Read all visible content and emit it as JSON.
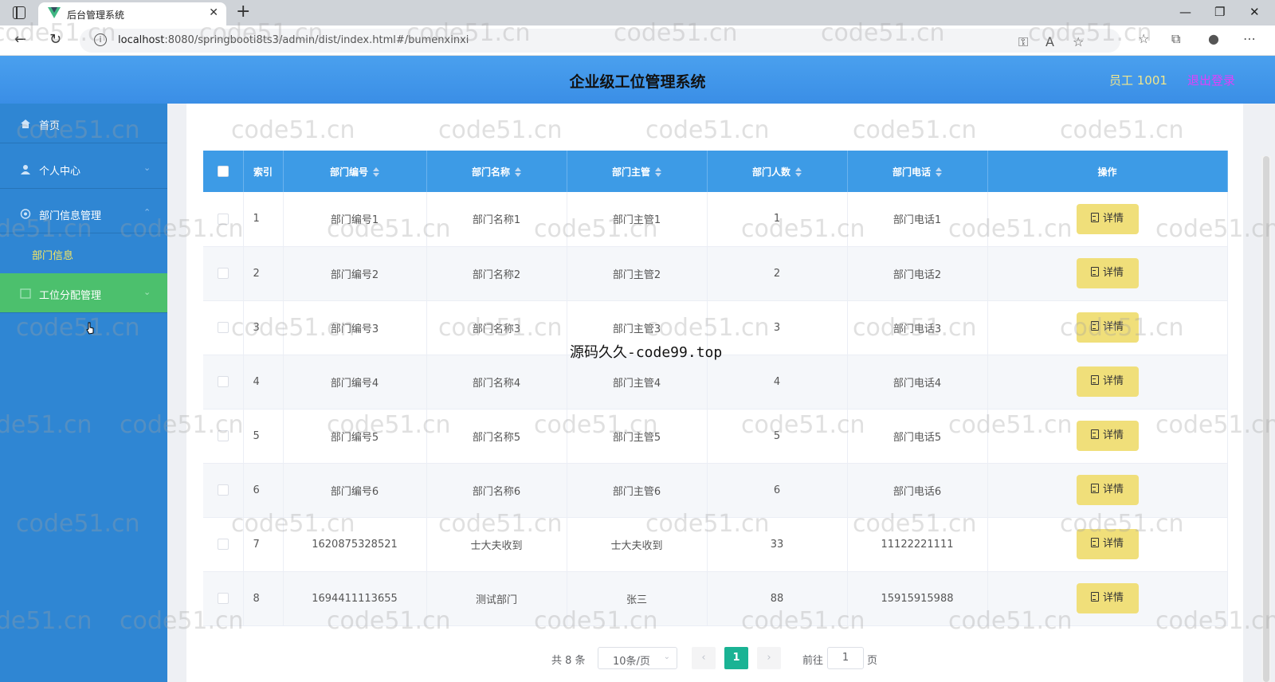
{
  "browser": {
    "tab_title": "后台管理系统",
    "url_host": "localhost",
    "url_rest": ":8080/springbooti8ts3/admin/dist/index.html#/bumenxinxi"
  },
  "header": {
    "title": "企业级工位管理系统",
    "user": "员工 1001",
    "logout": "退出登录"
  },
  "sidebar": {
    "items": [
      {
        "label": "首页"
      },
      {
        "label": "个人中心"
      },
      {
        "label": "部门信息管理"
      },
      {
        "label": "工位分配管理"
      }
    ],
    "sub_item": "部门信息"
  },
  "table": {
    "headers": {
      "index": "索引",
      "dept_no": "部门编号",
      "dept_name": "部门名称",
      "manager": "部门主管",
      "headcount": "部门人数",
      "phone": "部门电话",
      "ops": "操作"
    },
    "detail_label": "详情",
    "rows": [
      {
        "index": "1",
        "dept_no": "部门编号1",
        "dept_name": "部门名称1",
        "manager": "部门主管1",
        "headcount": "1",
        "phone": "部门电话1"
      },
      {
        "index": "2",
        "dept_no": "部门编号2",
        "dept_name": "部门名称2",
        "manager": "部门主管2",
        "headcount": "2",
        "phone": "部门电话2"
      },
      {
        "index": "3",
        "dept_no": "部门编号3",
        "dept_name": "部门名称3",
        "manager": "部门主管3",
        "headcount": "3",
        "phone": "部门电话3"
      },
      {
        "index": "4",
        "dept_no": "部门编号4",
        "dept_name": "部门名称4",
        "manager": "部门主管4",
        "headcount": "4",
        "phone": "部门电话4"
      },
      {
        "index": "5",
        "dept_no": "部门编号5",
        "dept_name": "部门名称5",
        "manager": "部门主管5",
        "headcount": "5",
        "phone": "部门电话5"
      },
      {
        "index": "6",
        "dept_no": "部门编号6",
        "dept_name": "部门名称6",
        "manager": "部门主管6",
        "headcount": "6",
        "phone": "部门电话6"
      },
      {
        "index": "7",
        "dept_no": "1620875328521",
        "dept_name": "士大夫收到",
        "manager": "士大夫收到",
        "headcount": "33",
        "phone": "11122221111"
      },
      {
        "index": "8",
        "dept_no": "1694411113655",
        "dept_name": "测试部门",
        "manager": "张三",
        "headcount": "88",
        "phone": "15915915988"
      }
    ]
  },
  "pagination": {
    "total": "共 8 条",
    "page_size": "10条/页",
    "current_page": "1",
    "goto_label": "前往",
    "goto_value": "1",
    "page_suffix": "页"
  },
  "watermark": {
    "text": "code51.cn",
    "center_text": "源码久久-code99.top"
  }
}
